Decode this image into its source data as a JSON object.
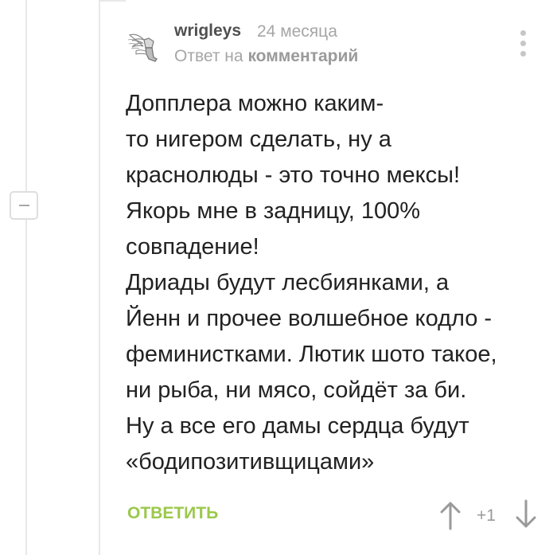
{
  "comment": {
    "author": "wrigleys",
    "timestamp": "24 месяца",
    "reply_prefix": "Ответ на",
    "reply_link": "комментарий",
    "body_lines": [
      "Допплера можно каким-",
      "то нигером сделать, ну а",
      "краснолюды - это точно мексы!",
      "Якорь мне в задницу, 100%",
      "совпадение!",
      "Дриады будут лесбиянками, а",
      "Йенн и прочее волшебное кодло -",
      "феминистками. Лютик шото такое,",
      "ни рыба, ни мясо, сойдёт за би.",
      "Ну а все его дамы сердца будут",
      "«бодипозитивщицами»"
    ],
    "reply_button": "ОТВЕТИТЬ",
    "rating": "+1"
  },
  "icons": {
    "avatar": "winged-hand-avatar-icon",
    "menu": "more-vertical-icon",
    "collapse": "minus-icon",
    "vote_up": "arrow-up-icon",
    "vote_down": "arrow-down-icon"
  },
  "colors": {
    "accent_green": "#9bc84b",
    "muted_text": "#a6a6a6",
    "author_text": "#4f4f4f",
    "body_text": "#222222",
    "thread_line": "#e8e8e8"
  }
}
